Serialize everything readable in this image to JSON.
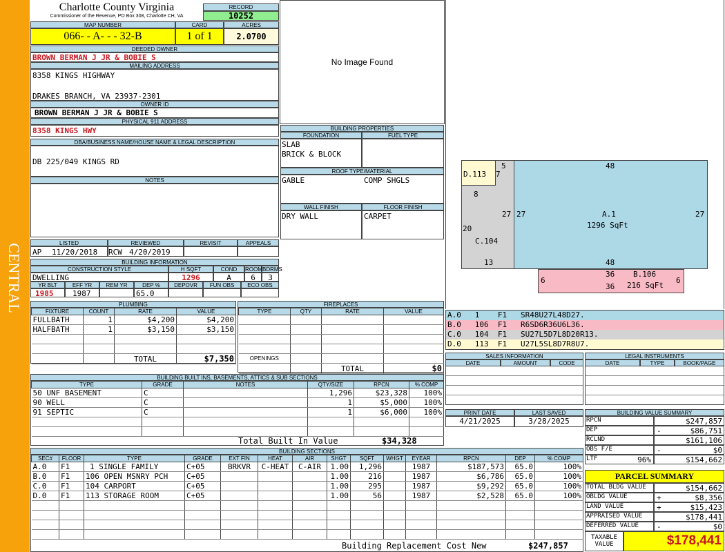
{
  "sidebar": {
    "label": "CENTRAL"
  },
  "header": {
    "county": "Charlotte County Virginia",
    "commissioner": "Commissioner of the Revenue, PO Box 308, Charlotte CH, VA",
    "record_label": "RECORD",
    "record": "10252",
    "map_number_label": "MAP NUMBER",
    "map_number": "066-  - A-  -  - 32-B",
    "card_label": "CARD",
    "card": "1 of 1",
    "acres_label": "ACRES",
    "acres": "2.0700"
  },
  "owner": {
    "deeded_owner_label": "DEEDED OWNER",
    "deeded_owner": "BROWN BERMAN J JR & BOBIE S",
    "mailing_address_label": "MAILING ADDRESS",
    "mailing_line1": "8358 KINGS HIGHWAY",
    "mailing_line2": "DRAKES BRANCH, VA 23937-2301",
    "owner_id_label": "OWNER ID",
    "owner_id": "BROWN BERMAN J JR & BOBIE S",
    "physical_label": "PHYSICAL 911 ADDRESS",
    "physical": "8358 KINGS HWY",
    "dba_label": "DBA/BUSINESS NAME/HOUSE NAME & LEGAL DESCRIPTION",
    "dba": "DB 225/049 KINGS RD",
    "notes_label": "NOTES",
    "notes": ""
  },
  "photo": {
    "placeholder": "No Image Found"
  },
  "listing": {
    "listed_label": "LISTED",
    "reviewed_label": "REVIEWED",
    "revisit_label": "REVISIT",
    "appeals_label": "APPEALS",
    "listed_by": "AP",
    "listed_date": "11/20/2018",
    "reviewed_by": "RCW",
    "reviewed_date": "4/20/2019"
  },
  "building_info": {
    "label": "BUILDING INFORMATION",
    "cols1": [
      "CONSTRUCTION STYLE",
      "H SQFT",
      "COND",
      "ROOMS",
      "BDRMS"
    ],
    "style": "DWELLING",
    "hsqft": "1296",
    "cond": "A",
    "rooms": "6",
    "bdrms": "3",
    "cols2": [
      "YR BLT",
      "EFF YR",
      "REM YR",
      "DEP %",
      "DEPOVR",
      "FUN OBS",
      "ECO OBS"
    ],
    "yr_blt": "1985",
    "eff_yr": "1987",
    "rem_yr": "",
    "dep_pct": "65.0"
  },
  "building_props": {
    "label": "BUILDING PROPERTIES",
    "foundation_label": "FOUNDATION",
    "fuel_label": "FUEL TYPE",
    "foundation": [
      "SLAB",
      "BRICK & BLOCK"
    ],
    "roof_label": "ROOF TYPE/MATERIAL",
    "roof_type": "GABLE",
    "roof_material": "COMP SHGLS",
    "wall_label": "WALL FINISH",
    "floor_label": "FLOOR FINISH",
    "wall": "DRY WALL",
    "floor": "CARPET"
  },
  "sketch": {
    "areas": [
      {
        "code": "A.1",
        "sqft": "1296 SqFt"
      },
      {
        "code": "B.106",
        "sqft": "216 SqFt"
      },
      {
        "code": "C.104"
      },
      {
        "code": "D.113"
      }
    ],
    "dims": {
      "a_top": "48",
      "a_bottom": "48",
      "a_left": "27",
      "a_right": "27",
      "a_left2": "27",
      "d_5": "5",
      "d_7": "7",
      "c_8": "8",
      "c_20": "20",
      "c_13": "13",
      "b_6l": "6",
      "b_6r": "6",
      "b_36t": "36",
      "b_36b": "36"
    }
  },
  "section_codes": [
    {
      "text": "A.0   1    F1   SR48U27L48D27."
    },
    {
      "text": "B.0   106  F1   R6SD6R36U6L36."
    },
    {
      "text": "C.0   104  F1   SU27L5D7L8D20R13."
    },
    {
      "text": "D.0   113  F1   U27L5SL8D7R8U7."
    }
  ],
  "plumbing": {
    "label": "PLUMBING",
    "cols": [
      "FIXTURE",
      "COUNT",
      "RATE",
      "VALUE"
    ],
    "rows": [
      {
        "fixture": "FULLBATH",
        "count": "1",
        "rate": "$4,200",
        "value": "$4,200"
      },
      {
        "fixture": "HALFBATH",
        "count": "1",
        "rate": "$3,150",
        "value": "$3,150"
      }
    ],
    "total_label": "TOTAL",
    "total": "$7,350"
  },
  "fireplaces": {
    "label": "FIREPLACES",
    "cols": [
      "TYPE",
      "QTY",
      "RATE",
      "VALUE"
    ],
    "openings_label": "OPENINGS",
    "total_label": "TOTAL",
    "total": "$0"
  },
  "sales": {
    "label": "SALES INFORMATION",
    "cols": [
      "DATE",
      "AMOUNT",
      "CODE"
    ]
  },
  "legal": {
    "label": "LEGAL INSTRUMENTS",
    "cols": [
      "DATE",
      "TYPE",
      "BOOK/PAGE"
    ]
  },
  "dates": {
    "print_label": "PRINT DATE",
    "print": "4/21/2025",
    "saved_label": "LAST SAVED",
    "saved": "3/28/2025"
  },
  "builtins": {
    "label": "BUILDING BUILT INS, BASEMENTS, ATTICS & SUB SECTIONS",
    "cols": [
      "TYPE",
      "GRADE",
      "NOTES",
      "QTY/SIZE",
      "RPCN",
      "% COMP"
    ],
    "rows": [
      {
        "type": "50 UNF BASEMENT",
        "grade": "C",
        "qty": "1,296",
        "rpcn": "$23,328",
        "comp": "100%"
      },
      {
        "type": "90 WELL",
        "grade": "C",
        "qty": "1",
        "rpcn": "$5,000",
        "comp": "100%"
      },
      {
        "type": "91 SEPTIC",
        "grade": "C",
        "qty": "1",
        "rpcn": "$6,000",
        "comp": "100%"
      }
    ],
    "total_label": "Total Built In Value",
    "total": "$34,328"
  },
  "value_summary": {
    "label": "BUILDING VALUE SUMMARY",
    "rows": [
      {
        "label": "RPCN",
        "sign": "",
        "value": "$247,857"
      },
      {
        "label": "DEP",
        "sign": "-",
        "value": "$86,751"
      },
      {
        "label": "RCLND",
        "sign": "",
        "value": "$161,106"
      },
      {
        "label": "OBS F/E",
        "sign": "-",
        "value": "$0"
      },
      {
        "label": "LTF",
        "pct": "96%",
        "sign": "",
        "value": "$154,662"
      }
    ]
  },
  "parcel_summary": {
    "label": "PARCEL SUMMARY",
    "rows": [
      {
        "label": "TOTAL BLDG VALUE",
        "sign": "",
        "value": "$154,662"
      },
      {
        "label": "OBLDG VALUE",
        "sign": "+",
        "value": "$8,356"
      },
      {
        "label": "LAND VALUE",
        "sign": "+",
        "value": "$15,423"
      },
      {
        "label": "APPRAISED VALUE",
        "sign": "",
        "value": "$178,441"
      },
      {
        "label": "DEFERRED VALUE",
        "sign": "-",
        "value": "$0"
      }
    ],
    "taxable_label1": "TAXABLE",
    "taxable_label2": "VALUE",
    "taxable": "$178,441"
  },
  "sections": {
    "label": "BUILDING SECTIONS",
    "cols": [
      "SEC#",
      "FLOOR",
      "TYPE",
      "GRADE",
      "EXT FIN",
      "HEAT",
      "AIR",
      "SHGT",
      "SQFT",
      "WHGT",
      "EYEAR",
      "RPCN",
      "DEP",
      "% COMP"
    ],
    "rows": [
      {
        "sec": "A.0",
        "floor": "F1",
        "type": "1 SINGLE FAMILY",
        "grade": "C+05",
        "ext": "BRKVR",
        "heat": "C-HEAT",
        "air": "C-AIR",
        "shgt": "1.00",
        "sqft": "1,296",
        "whgt": "",
        "eyear": "1987",
        "rpcn": "$187,573",
        "dep": "65.0",
        "comp": "100%"
      },
      {
        "sec": "B.0",
        "floor": "F1",
        "type": "106 OPEN MSNRY PCH",
        "grade": "C+05",
        "ext": "",
        "heat": "",
        "air": "",
        "shgt": "1.00",
        "sqft": "216",
        "whgt": "",
        "eyear": "1987",
        "rpcn": "$6,786",
        "dep": "65.0",
        "comp": "100%"
      },
      {
        "sec": "C.0",
        "floor": "F1",
        "type": "104 CARPORT",
        "grade": "C+05",
        "ext": "",
        "heat": "",
        "air": "",
        "shgt": "1.00",
        "sqft": "295",
        "whgt": "",
        "eyear": "1987",
        "rpcn": "$9,292",
        "dep": "65.0",
        "comp": "100%"
      },
      {
        "sec": "D.0",
        "floor": "F1",
        "type": "113 STORAGE ROOM",
        "grade": "C+05",
        "ext": "",
        "heat": "",
        "air": "",
        "shgt": "1.00",
        "sqft": "56",
        "whgt": "",
        "eyear": "1987",
        "rpcn": "$2,528",
        "dep": "65.0",
        "comp": "100%"
      }
    ],
    "total_label": "Building Replacement Cost New",
    "total": "$247,857"
  }
}
